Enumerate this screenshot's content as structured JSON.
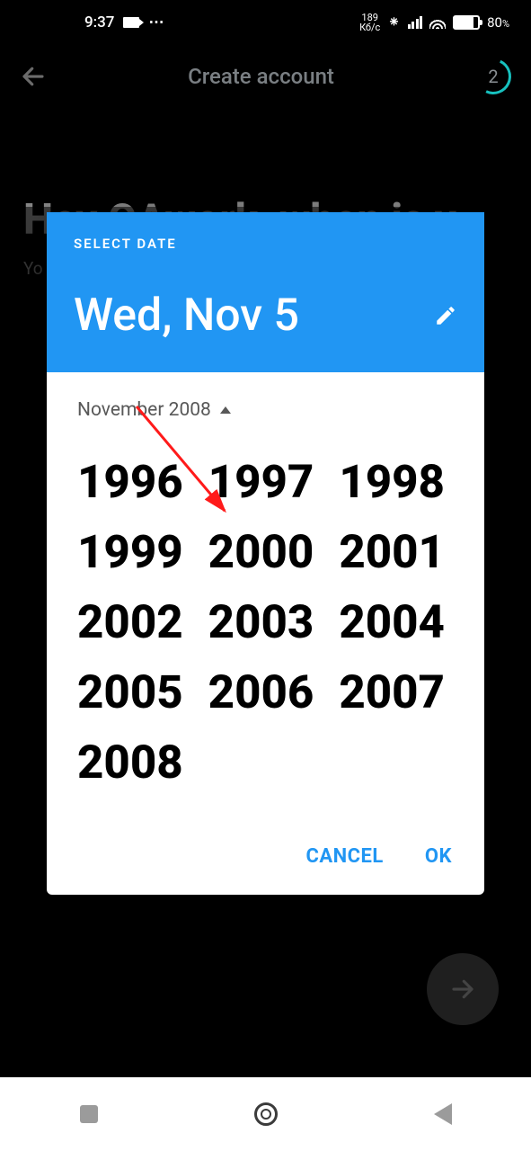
{
  "status": {
    "time": "9:37",
    "net_rate_top": "189",
    "net_rate_bottom": "Кб/с",
    "battery_pct": "80",
    "battery_suffix": "%"
  },
  "page": {
    "title": "Create account",
    "step": "2",
    "hero_line": "Hey QAwork, when is y",
    "sub_line": "Yo"
  },
  "dialog": {
    "eyebrow": "SELECT DATE",
    "selected_date": "Wed, Nov 5",
    "month_label": "November 2008",
    "years": [
      "1996",
      "1997",
      "1998",
      "1999",
      "2000",
      "2001",
      "2002",
      "2003",
      "2004",
      "2005",
      "2006",
      "2007",
      "2008"
    ],
    "cancel": "CANCEL",
    "ok": "OK"
  }
}
